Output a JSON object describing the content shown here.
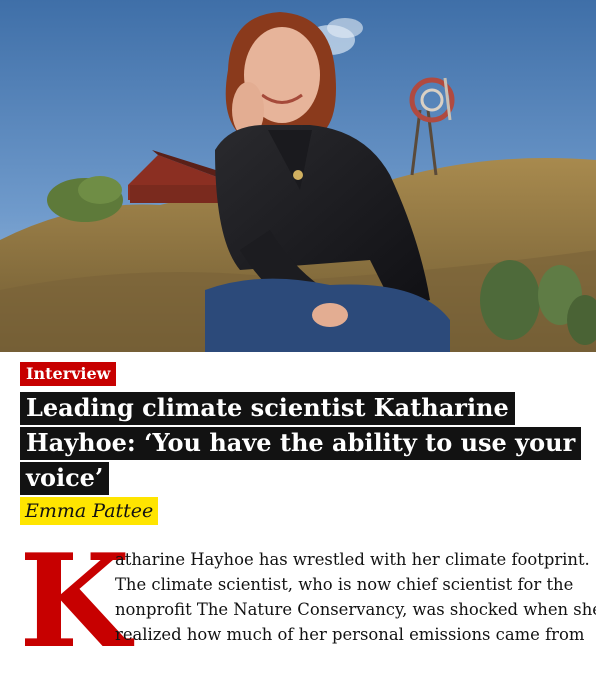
{
  "hero": {
    "image_label": "Portrait of Katharine Hayhoe sitting on a hillside with a windmill and red barn"
  },
  "article": {
    "kicker": "Interview",
    "headline": "Leading climate scientist Katharine Hayhoe: ‘You have the ability to use your voice’",
    "byline": "Emma Pattee",
    "dropcap": "K",
    "body_lines": [
      "atharine Hayhoe has wrestled with her climate footprint.",
      "The climate scientist, who is now chief scientist for the",
      "nonprofit The Nature Conservancy, was shocked when she",
      "realized how much of her personal emissions came from"
    ]
  },
  "colors": {
    "kicker_bg": "#c70000",
    "headline_bg": "#121212",
    "byline_bg": "#ffe500",
    "dropcap": "#c70000"
  }
}
